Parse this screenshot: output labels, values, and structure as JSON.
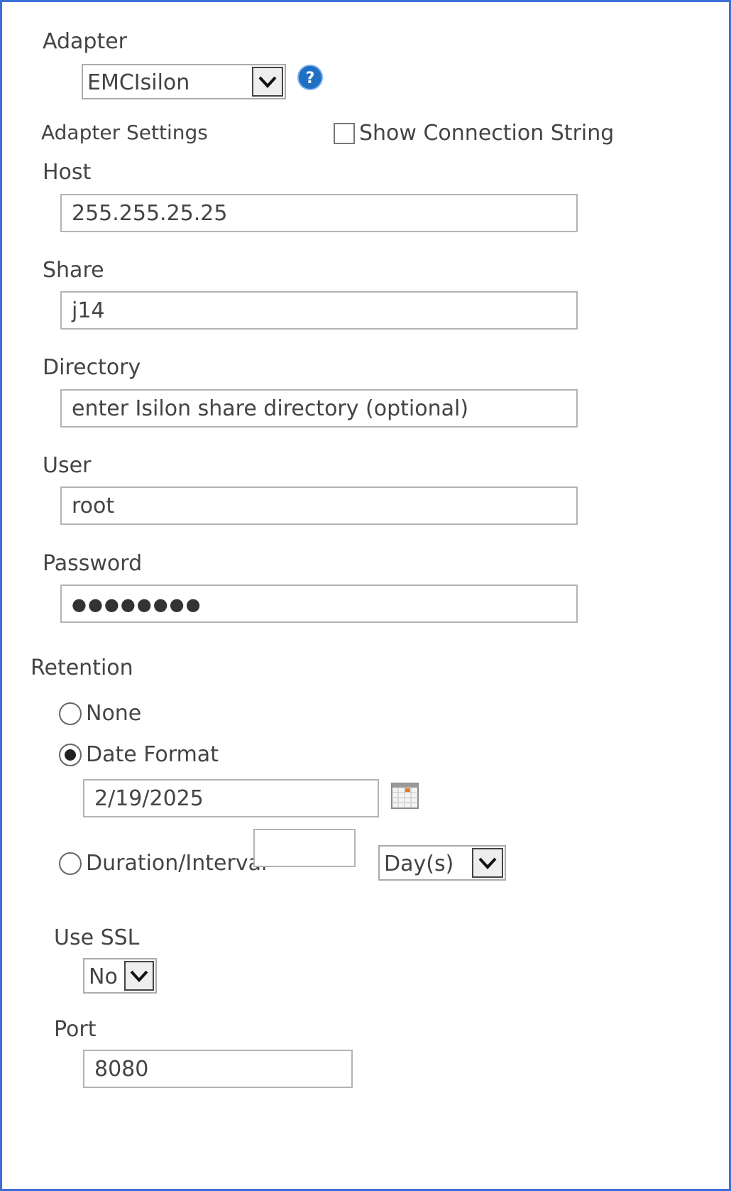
{
  "adapter": {
    "label": "Adapter",
    "selected": "EMCIsilon",
    "help_icon": "question-circle-icon"
  },
  "settings": {
    "label": "Adapter Settings",
    "show_connection_string": {
      "label": "Show Connection String",
      "checked": false
    }
  },
  "fields": {
    "host": {
      "label": "Host",
      "value": "255.255.25.25"
    },
    "share": {
      "label": "Share",
      "value": "j14"
    },
    "directory": {
      "label": "Directory",
      "placeholder": "enter Isilon share directory (optional)"
    },
    "user": {
      "label": "User",
      "value": "root"
    },
    "password": {
      "label": "Password",
      "masked": "●●●●●●●●"
    }
  },
  "retention": {
    "label": "Retention",
    "options": {
      "none": {
        "label": "None",
        "selected": false
      },
      "date_format": {
        "label": "Date Format",
        "selected": true
      },
      "duration": {
        "label": "Duration/Interval",
        "selected": false
      }
    },
    "date_value": "2/19/2025",
    "calendar_icon": "calendar-icon",
    "duration_value": "",
    "unit_selected": "Day(s)"
  },
  "ssl": {
    "label": "Use SSL",
    "selected": "No"
  },
  "port": {
    "label": "Port",
    "value": "8080"
  },
  "colors": {
    "frame_border": "#3d6fd9",
    "help_icon": "#1f6fc4",
    "text": "#444444"
  }
}
